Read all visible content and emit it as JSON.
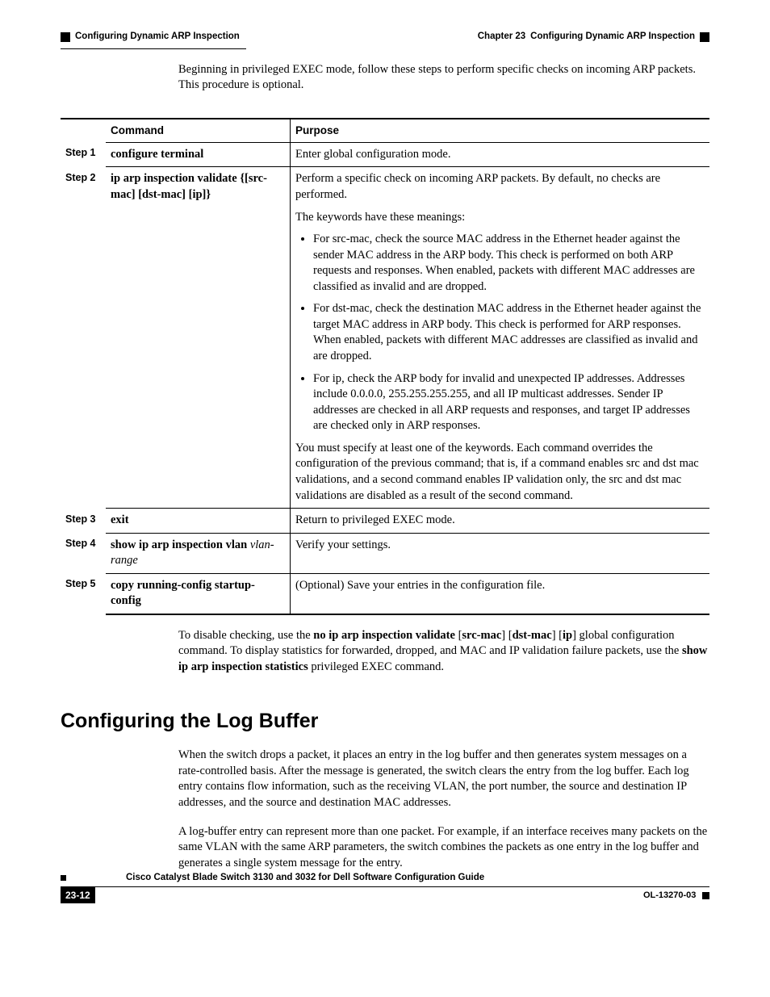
{
  "header": {
    "left_section": "Configuring Dynamic ARP Inspection",
    "right_chapter": "Chapter 23",
    "right_title": "Configuring Dynamic ARP Inspection"
  },
  "intro_para": "Beginning in privileged EXEC mode, follow these steps to perform specific checks on incoming ARP packets. This procedure is optional.",
  "table": {
    "head_command": "Command",
    "head_purpose": "Purpose",
    "steps": [
      {
        "step": "Step 1",
        "command": "configure terminal",
        "purpose_html": "Enter global configuration mode."
      },
      {
        "step": "Step 2",
        "command_html": "ip arp inspection validate {[src-mac] [dst-mac] [ip]}",
        "purpose_intro": "Perform a specific check on incoming ARP packets. By default, no checks are performed.",
        "purpose_keywords_label": "The keywords have these meanings:",
        "bullets": {
          "b1_pre": "For ",
          "b1_kw": "src-mac",
          "b1_post": ", check the source MAC address in the Ethernet header against the sender MAC address in the ARP body. This check is performed on both ARP requests and responses. When enabled, packets with different MAC addresses are classified as invalid and are dropped.",
          "b2_pre": "For ",
          "b2_kw": "dst-mac",
          "b2_post": ", check the destination MAC address in the Ethernet header against the target MAC address in ARP body. This check is performed for ARP responses. When enabled, packets with different MAC addresses are classified as invalid and are dropped.",
          "b3_pre": "For ",
          "b3_kw": "ip",
          "b3_post": ", check the ARP body for invalid and unexpected IP addresses. Addresses include 0.0.0.0, 255.255.255.255, and all IP multicast addresses. Sender IP addresses are checked in all ARP requests and responses, and target IP addresses are checked only in ARP responses."
        },
        "purpose_trailer_1": "You must specify at least one of the keywords. Each command overrides the configuration of the previous command; that is, if a command enables ",
        "purpose_trailer_kw1": "src",
        "purpose_trailer_2": " and ",
        "purpose_trailer_kw2": "dst mac",
        "purpose_trailer_3": " validations, and a second command enables IP validation only, the ",
        "purpose_trailer_kw3": "src",
        "purpose_trailer_4": " and ",
        "purpose_trailer_kw4": "dst mac",
        "purpose_trailer_5": " validations are disabled as a result of the second command."
      },
      {
        "step": "Step 3",
        "command": "exit",
        "purpose_html": "Return to privileged EXEC mode."
      },
      {
        "step": "Step 4",
        "command_main": "show ip arp inspection vlan",
        "command_arg": "vlan-range",
        "purpose_html": "Verify your settings."
      },
      {
        "step": "Step 5",
        "command": "copy running-config startup-config",
        "purpose_html": "(Optional) Save your entries in the configuration file."
      }
    ]
  },
  "after_table": {
    "t1": "To disable checking, use the ",
    "kw1": "no ip arp inspection validate",
    "t2": " [",
    "kw2": "src-mac",
    "t3": "] [",
    "kw3": "dst-mac",
    "t4": "] [",
    "kw4": "ip",
    "t5": "] global configuration command. To display statistics for forwarded, dropped, and MAC and IP validation failure packets, use the ",
    "kw5": "show ip arp inspection statistics",
    "t6": " privileged EXEC command."
  },
  "section_heading": "Configuring the Log Buffer",
  "section_p1": "When the switch drops a packet, it places an entry in the log buffer and then generates system messages on a rate-controlled basis. After the message is generated, the switch clears the entry from the log buffer. Each log entry contains flow information, such as the receiving VLAN, the port number, the source and destination IP addresses, and the source and destination MAC addresses.",
  "section_p2": "A log-buffer entry can represent more than one packet. For example, if an interface receives many packets on the same VLAN with the same ARP parameters, the switch combines the packets as one entry in the log buffer and generates a single system message for the entry.",
  "footer": {
    "guide_title": "Cisco Catalyst Blade Switch 3130 and 3032 for Dell Software Configuration Guide",
    "page_number": "23-12",
    "doc_id": "OL-13270-03"
  }
}
